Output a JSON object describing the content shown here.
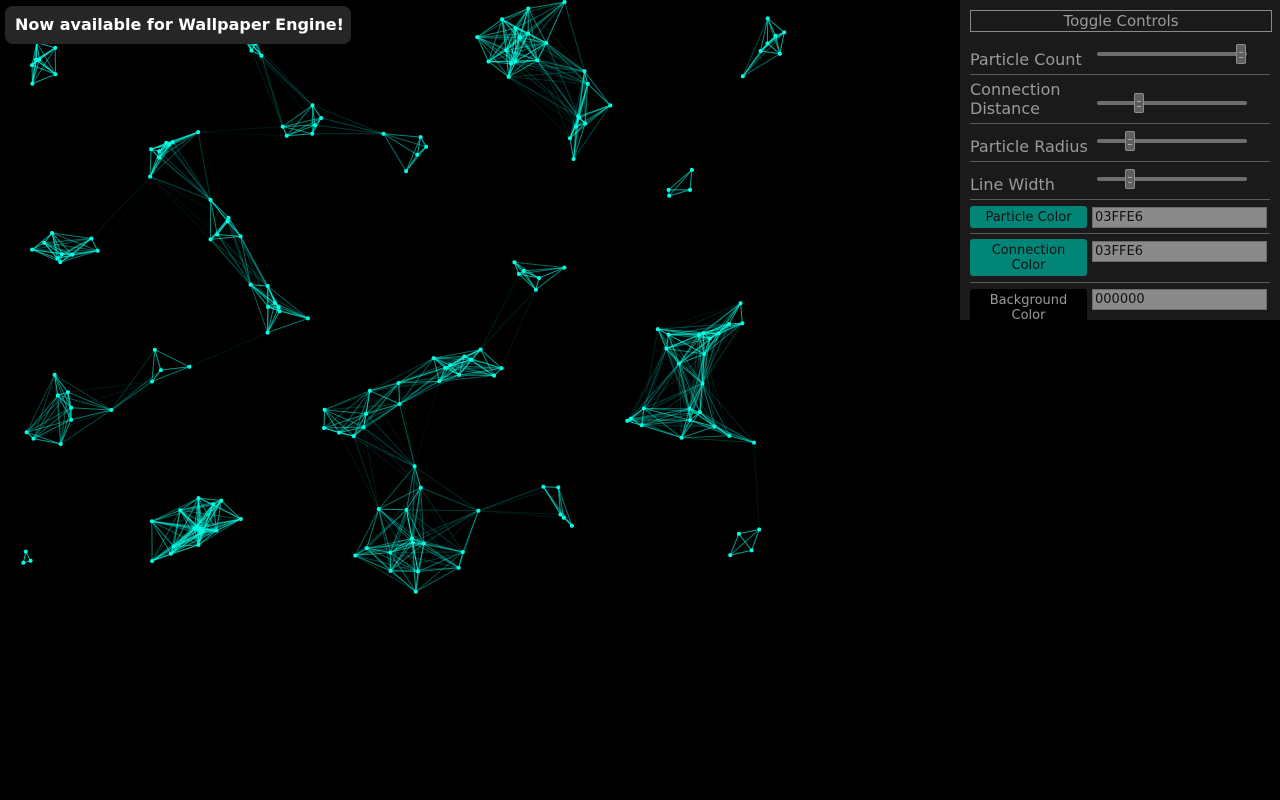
{
  "banner": {
    "text": "Now available for Wallpaper Engine!"
  },
  "controls": {
    "toggle_label": "Toggle Controls",
    "sliders": [
      {
        "label": "Particle Count",
        "value": 0.96
      },
      {
        "label": "Connection Distance",
        "value": 0.28
      },
      {
        "label": "Particle Radius",
        "value": 0.22
      },
      {
        "label": "Line Width",
        "value": 0.22
      }
    ],
    "colors": [
      {
        "label": "Particle Color",
        "value": "03FFE6",
        "swatch": "#008577",
        "text_color": "#111111"
      },
      {
        "label": "Connection Color",
        "value": "03FFE6",
        "swatch": "#008577",
        "text_color": "#111111"
      },
      {
        "label": "Background Color",
        "value": "000000",
        "swatch": "#000000",
        "text_color": "#9a9a9a"
      }
    ]
  },
  "style": {
    "particle_color": "#03FFE6",
    "connection_color": "#03FFE6",
    "background_color": "#000000",
    "panel_color": "#1a1a1a"
  }
}
